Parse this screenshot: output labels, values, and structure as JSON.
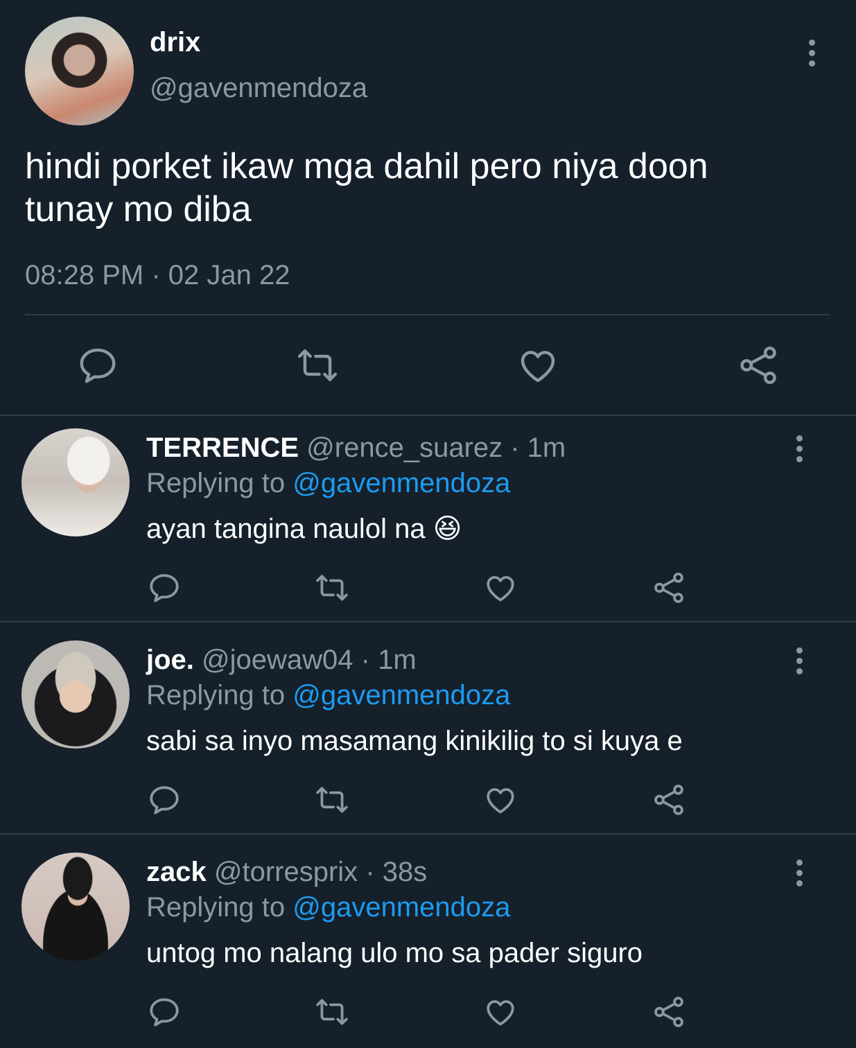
{
  "main_tweet": {
    "display_name": "drix",
    "handle": "@gavenmendoza",
    "text_line1": "hindi porket ikaw mga dahil pero niya doon",
    "text_line2": "tunay mo diba",
    "time": "08:28 PM",
    "separator": "·",
    "date": "02 Jan 22"
  },
  "icons": {
    "reply": "reply-icon",
    "retweet": "retweet-icon",
    "like": "heart-icon",
    "share": "share-icon",
    "more": "more-vertical-icon"
  },
  "replies": [
    {
      "display_name": "TERRENCE",
      "handle": "@rence_suarez",
      "age": "· 1m",
      "replying_prefix": "Replying to",
      "replying_to": "@gavenmendoza",
      "text": "ayan tangina naulol na",
      "emoji": "😆"
    },
    {
      "display_name": "joe.",
      "handle": "@joewaw04",
      "age": "· 1m",
      "replying_prefix": "Replying to",
      "replying_to": "@gavenmendoza",
      "text": "sabi sa inyo masamang kinikilig to si kuya e"
    },
    {
      "display_name": "zack",
      "handle": "@torresprix",
      "age": "· 38s",
      "replying_prefix": "Replying to",
      "replying_to": "@gavenmendoza",
      "text": "untog mo nalang ulo mo sa pader siguro"
    }
  ],
  "colors": {
    "background": "#15202b",
    "muted": "#8b98a5",
    "link": "#1d9bf0",
    "divider": "#2f3b47"
  }
}
